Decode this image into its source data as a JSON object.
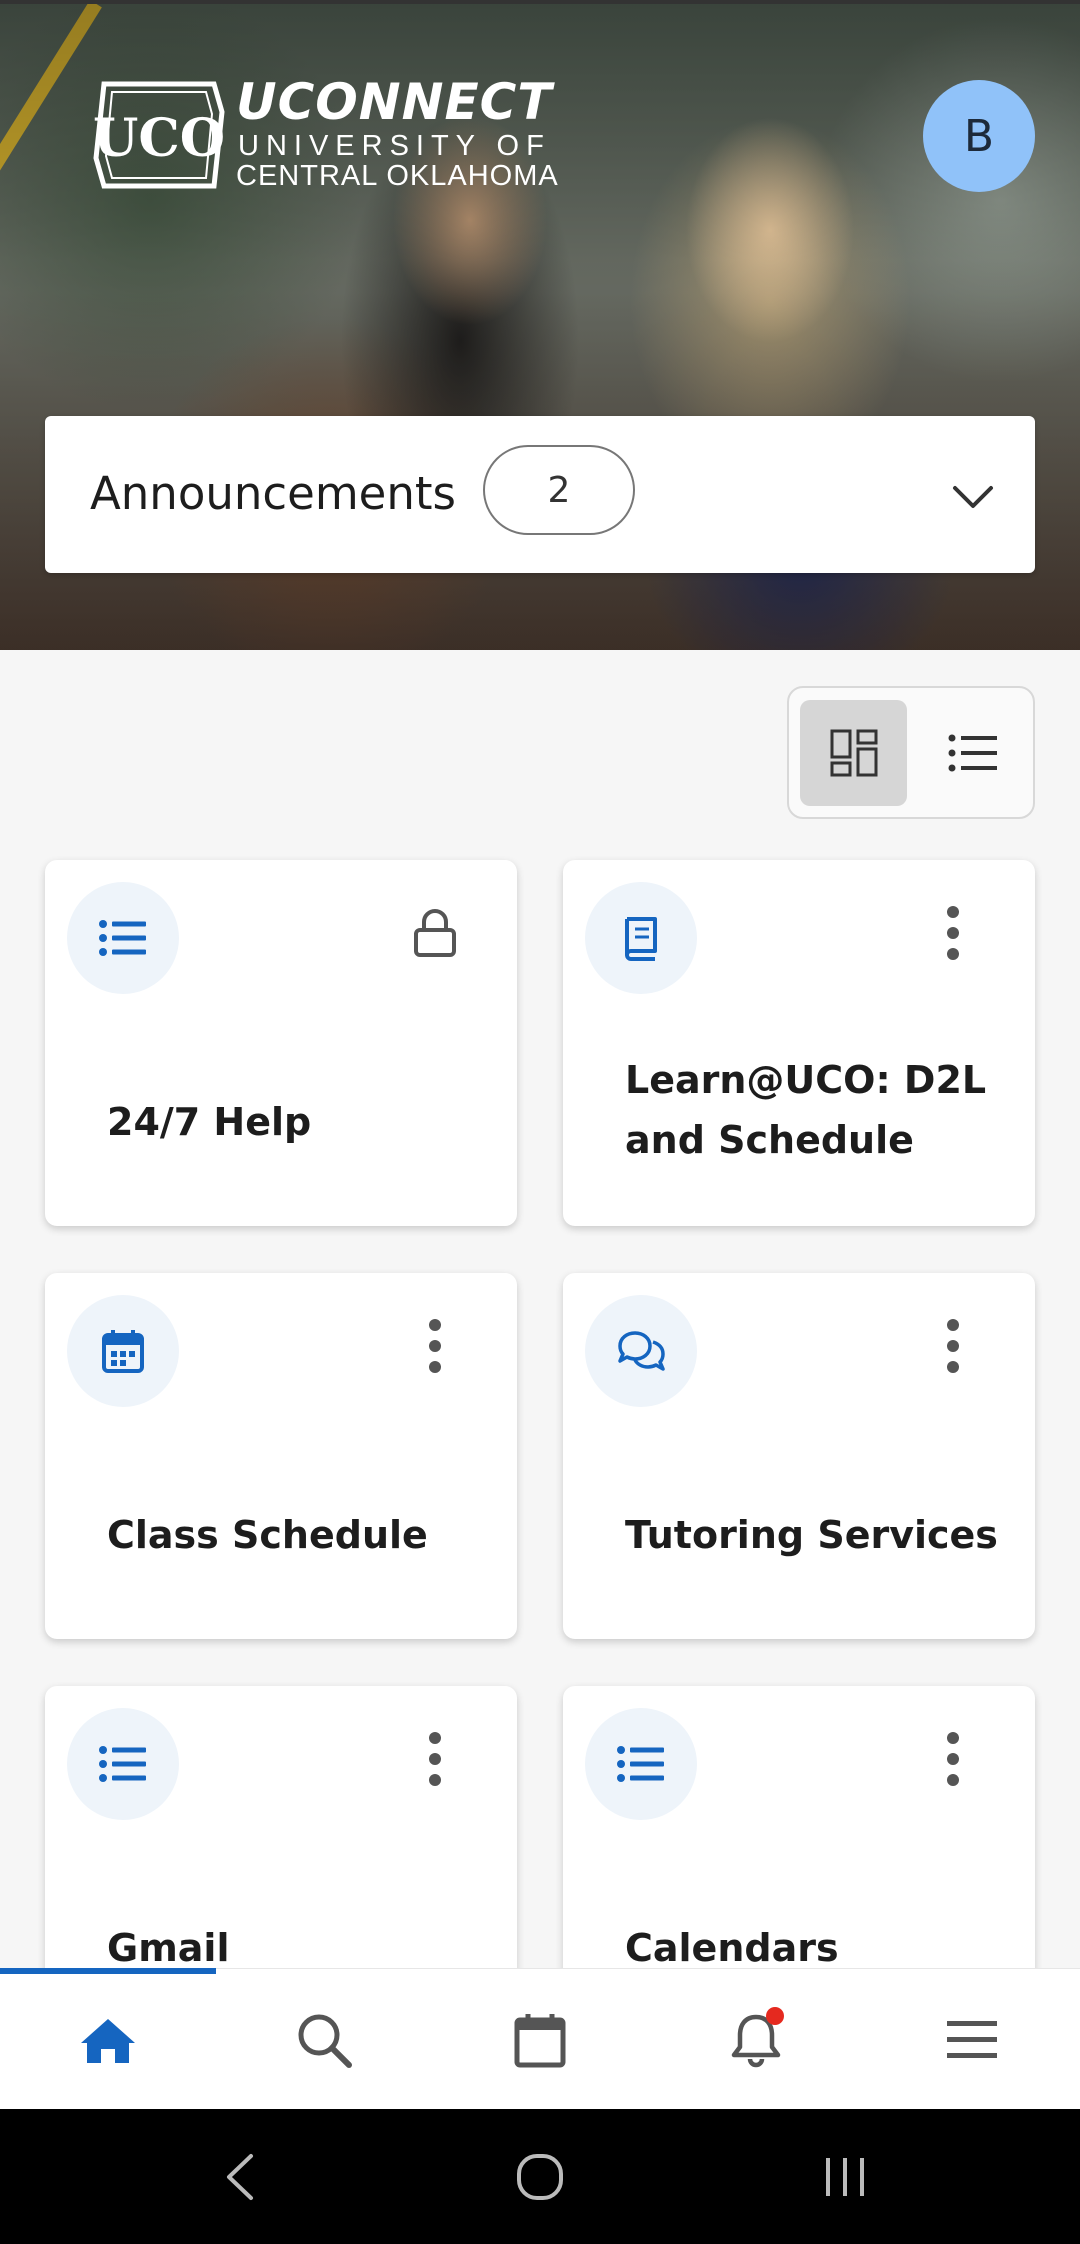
{
  "header": {
    "logo_title": "UCONNECT",
    "logo_line1": "UNIVERSITY OF",
    "logo_line2": "CENTRAL OKLAHOMA",
    "logo_mark_text": "UCO",
    "avatar_initial": "B"
  },
  "announcements": {
    "label": "Announcements",
    "count": "2",
    "icon": "chevron-down-icon"
  },
  "view_toggle": {
    "selected": "grid",
    "options": [
      "grid-view-icon",
      "list-view-icon"
    ]
  },
  "cards": [
    {
      "title": "24/7 Help",
      "icon": "list-icon",
      "action_icon": "lock-icon"
    },
    {
      "title": "Learn@UCO: D2L and Schedule",
      "icon": "book-icon",
      "action_icon": "more-vertical-icon"
    },
    {
      "title": "Class Schedule",
      "icon": "calendar-icon",
      "action_icon": "more-vertical-icon"
    },
    {
      "title": "Tutoring Services",
      "icon": "chat-bubbles-icon",
      "action_icon": "more-vertical-icon"
    },
    {
      "title": "Gmail",
      "icon": "list-icon",
      "action_icon": "more-vertical-icon"
    },
    {
      "title": "Calendars",
      "icon": "list-icon",
      "action_icon": "more-vertical-icon"
    }
  ],
  "bottom_nav": {
    "active": "home",
    "items": [
      "home-icon",
      "search-icon",
      "calendar-icon",
      "bell-icon",
      "menu-icon"
    ],
    "notification_dot": true
  },
  "colors": {
    "accent_blue": "#1565c0",
    "avatar_bg": "#90c2f9",
    "icon_circle_bg": "#eef4fa",
    "badge_red": "#e5291f",
    "gold_stripe": "#c7a52b"
  }
}
